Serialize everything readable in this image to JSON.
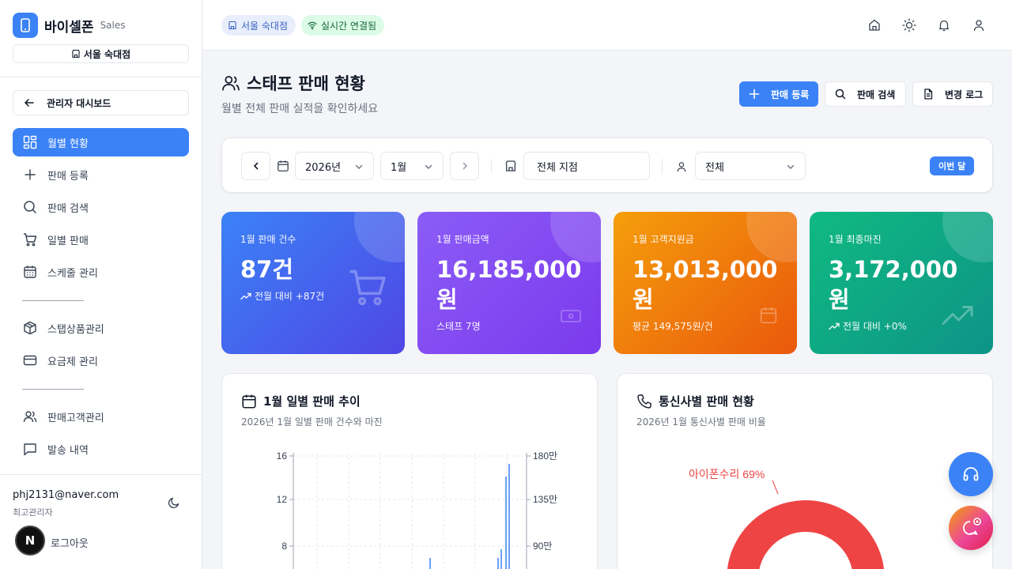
{
  "brand": {
    "name": "바이셀폰",
    "sub": "Sales",
    "store": "서울 숙대점"
  },
  "sidebar": {
    "back_label": "관리자 대시보드",
    "items": [
      {
        "label": "월별 현황",
        "icon": "grid-icon",
        "active": true
      },
      {
        "label": "판매 등록",
        "icon": "plus-icon"
      },
      {
        "label": "판매 검색",
        "icon": "search-icon"
      },
      {
        "label": "일별 판매",
        "icon": "cart-icon"
      },
      {
        "label": "스케줄 관리",
        "icon": "calendar-icon"
      },
      {
        "label": "스탭상품관리",
        "icon": "box-icon"
      },
      {
        "label": "요금제 관리",
        "icon": "card-icon"
      },
      {
        "label": "판매고객관리",
        "icon": "users-icon"
      },
      {
        "label": "발송 내역",
        "icon": "message-icon"
      }
    ],
    "user_email": "phj2131@naver.com",
    "user_role": "최고관리자",
    "avatar_letter": "N",
    "logout": "로그아웃"
  },
  "topbar": {
    "store_chip": "서울 숙대점",
    "live_chip": "실시간 연결됨"
  },
  "header": {
    "title": "스태프 판매 현황",
    "subtitle": "월별 전체 판매 실적을 확인하세요",
    "register_btn": "판매 등록",
    "search_btn": "판매 검색",
    "log_btn": "변경 로그"
  },
  "filters": {
    "year": "2026년",
    "month": "1월",
    "branch": "전체 지점",
    "staff": "전체",
    "this_month": "이번 달"
  },
  "stats": [
    {
      "label": "1월 판매 건수",
      "value": "87건",
      "foot": "전월 대비 +87건",
      "color_from": "#3b82f6",
      "color_to": "#4f46e5"
    },
    {
      "label": "1월 판매금액",
      "value": "16,185,000원",
      "foot": "스태프 7명",
      "color_from": "#8b5cf6",
      "color_to": "#7c3aed"
    },
    {
      "label": "1월 고객지원금",
      "value": "13,013,000원",
      "foot": "평균 149,575원/건",
      "color_from": "#f59e0b",
      "color_to": "#ea580c"
    },
    {
      "label": "1월 최종마진",
      "value": "3,172,000원",
      "foot": "전월 대비 +0%",
      "color_from": "#10b981",
      "color_to": "#0d9488"
    }
  ],
  "daily_panel": {
    "title": "1월 일별 판매 추이",
    "subtitle": "2026년 1월 일별 판매 건수와 마진"
  },
  "carrier_panel": {
    "title": "통신사별 판매 현황",
    "subtitle": "2026년 1월 통신사별 판매 비율",
    "slice_label": "아이폰수리 69%"
  },
  "chart_data": {
    "type": "bar",
    "left_axis_ticks": [
      "16",
      "12",
      "8"
    ],
    "right_axis_ticks": [
      "180만",
      "135만",
      "90만"
    ],
    "ylim_left": [
      0,
      16
    ],
    "ylim_right": [
      0,
      1800000
    ]
  },
  "colors": {
    "accent": "#3b82f6",
    "pie": "#ef4444"
  }
}
